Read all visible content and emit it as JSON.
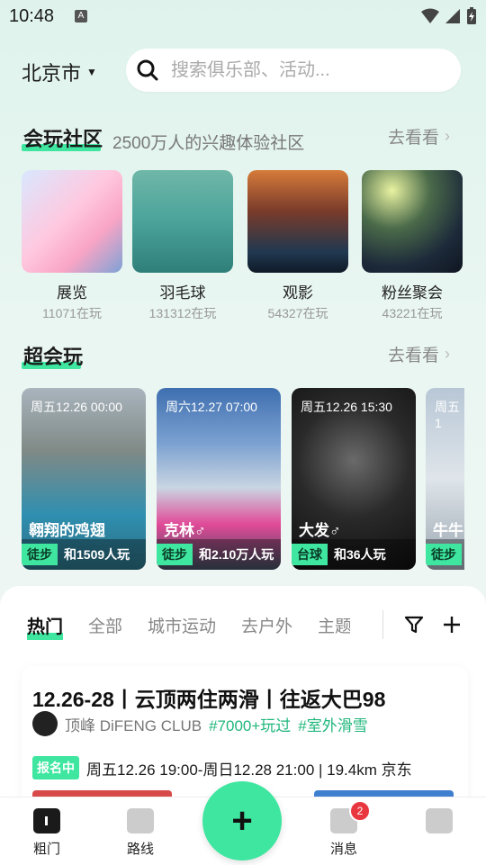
{
  "status": {
    "time": "10:48",
    "notif": "A"
  },
  "header": {
    "city": "北京市",
    "search_placeholder": "搜索俱乐部、活动..."
  },
  "community": {
    "title": "会玩社区",
    "subtitle": "2500万人的兴趣体验社区",
    "more": "去看看",
    "items": [
      {
        "name": "展览",
        "count": "11071在玩"
      },
      {
        "name": "羽毛球",
        "count": "131312在玩"
      },
      {
        "name": "观影",
        "count": "54327在玩"
      },
      {
        "name": "粉丝聚会",
        "count": "43221在玩"
      }
    ]
  },
  "super": {
    "title": "超会玩",
    "more": "去看看",
    "cards": [
      {
        "date": "周五12.26 00:00",
        "title": "翱翔的鸡翅",
        "tag": "徒步",
        "join": "和1509人玩"
      },
      {
        "date": "周六12.27 07:00",
        "title": "克林♂",
        "tag": "徒步",
        "join": "和2.10万人玩"
      },
      {
        "date": "周五12.26 15:30",
        "title": "大发♂",
        "tag": "台球",
        "join": "和36人玩"
      },
      {
        "date": "周五1",
        "title": "牛牛",
        "tag": "徒步",
        "join": ""
      }
    ]
  },
  "tabs": {
    "items": [
      "热门",
      "全部",
      "城市运动",
      "去户外",
      "主题"
    ]
  },
  "post": {
    "title": "12.26-28丨云顶两住两滑丨往返大巴98",
    "club": "顶峰 DiFENG CLUB",
    "hashtags": [
      "#7000+玩过",
      "#室外滑雪"
    ],
    "badge": "报名中",
    "schedule": "周五12.26 19:00-周日12.28 21:00 | 19.4km 京东"
  },
  "nav": {
    "items": [
      "粗门",
      "路线",
      "消息",
      ""
    ],
    "fab": "+",
    "message_badge": "2"
  },
  "colors": {
    "accent": "#3ee6a0",
    "hashtag": "#21b77c",
    "badge_red": "#e8373e"
  }
}
